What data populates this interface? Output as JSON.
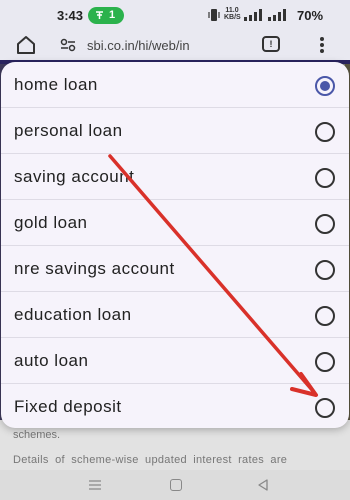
{
  "status_bar": {
    "time": "3:43",
    "pill_text": "1",
    "net_speed_top": "11.0",
    "net_speed_bottom": "KB/S",
    "battery": "70%"
  },
  "browser": {
    "url": "sbi.co.in/hi/web/in",
    "tabs_count": "!"
  },
  "dialog": {
    "options": [
      {
        "label": "home loan",
        "selected": true
      },
      {
        "label": "personal loan",
        "selected": false
      },
      {
        "label": "saving account",
        "selected": false
      },
      {
        "label": "gold loan",
        "selected": false
      },
      {
        "label": "nre savings account",
        "selected": false
      },
      {
        "label": "education loan",
        "selected": false
      },
      {
        "label": "auto loan",
        "selected": false
      },
      {
        "label": "Fixed deposit",
        "selected": false
      }
    ]
  },
  "background_page": {
    "line1": "schemes.",
    "line2": "Details of scheme-wise updated interest rates are"
  },
  "colors": {
    "radio_selected": "#4a57a8",
    "arrow": "#d9312a",
    "status_pill": "#2bb24c"
  }
}
